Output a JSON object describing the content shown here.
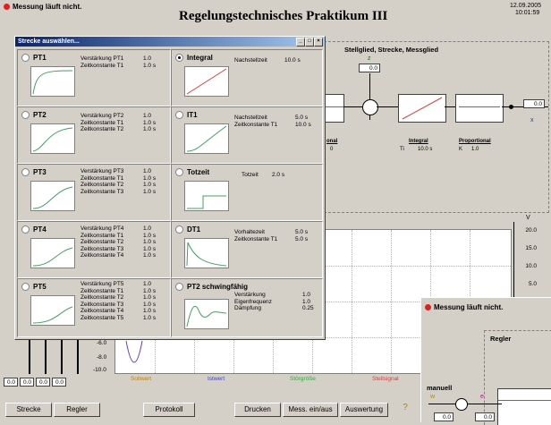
{
  "status": "Messung läuft nicht.",
  "title": "Regelungstechnisches Praktikum III",
  "date": "12.09.2005",
  "time": "10:01:59",
  "diagram": {
    "heading": "Stellglied, Strecke, Messglied",
    "z_label": "z",
    "z_value": "0.0",
    "x_label": "x",
    "x_value": "0.0",
    "blocks": [
      {
        "name": "onal",
        "param": "0"
      },
      {
        "name": "Integral",
        "param_label": "Ti",
        "param_value": "10.0 s"
      },
      {
        "name": "Proportional",
        "param_label": "K",
        "param_value": "1.0"
      }
    ]
  },
  "graph": {
    "unit": "V",
    "y_ticks": [
      "20.0",
      "15.0",
      "10.0",
      "5.0"
    ],
    "lower_ticks": [
      "-6.0",
      "-8.0",
      "-10.0"
    ],
    "legend": {
      "sollwert": "Sollwert",
      "istwert": "Istwert",
      "stoergroesse": "Störgröße",
      "stellsignal": "Stellsignal"
    },
    "colors": {
      "sollwert": "#c08000",
      "istwert": "#4040c0",
      "stoergroesse": "#40a040",
      "stellsignal": "#d04040"
    }
  },
  "slider_values": [
    "0.0",
    "0.0",
    "0.0",
    "0.0"
  ],
  "buttons": {
    "strecke": "Strecke",
    "regler": "Regler",
    "protokoll": "Protokoll",
    "drucken": "Drucken",
    "mess": "Mess. ein/aus",
    "auswertung": "Auswertung"
  },
  "dialog": {
    "title": "Strecke auswählen...",
    "controls": {
      "minimize": "_",
      "maximize": "□",
      "close": "×"
    },
    "left": [
      {
        "name": "PT1",
        "params": [
          [
            "Verstärkung PT1",
            "1.0"
          ],
          [
            "Zeitkonstante T1",
            "1.0 s"
          ]
        ]
      },
      {
        "name": "PT2",
        "params": [
          [
            "Verstärkung PT2",
            "1.0"
          ],
          [
            "Zeitkonstante T1",
            "1.0 s"
          ],
          [
            "Zeitkonstante T2",
            "1.0 s"
          ]
        ]
      },
      {
        "name": "PT3",
        "params": [
          [
            "Verstärkung PT3",
            "1.0"
          ],
          [
            "Zeitkonstante T1",
            "1.0 s"
          ],
          [
            "Zeitkonstante T2",
            "1.0 s"
          ],
          [
            "Zeitkonstante T3",
            "1.0 s"
          ]
        ]
      },
      {
        "name": "PT4",
        "params": [
          [
            "Verstärkung PT4",
            "1.0"
          ],
          [
            "Zeitkonstante T1",
            "1.0 s"
          ],
          [
            "Zeitkonstante T2",
            "1.0 s"
          ],
          [
            "Zeitkonstante T3",
            "1.0 s"
          ],
          [
            "Zeitkonstante T4",
            "1.0 s"
          ]
        ]
      },
      {
        "name": "PT5",
        "params": [
          [
            "Verstärkung PT5",
            "1.0"
          ],
          [
            "Zeitkonstante T1",
            "1.0 s"
          ],
          [
            "Zeitkonstante T2",
            "1.0 s"
          ],
          [
            "Zeitkonstante T3",
            "1.0 s"
          ],
          [
            "Zeitkonstante T4",
            "1.0 s"
          ],
          [
            "Zeitkonstante T5",
            "1.0 s"
          ]
        ]
      }
    ],
    "right": [
      {
        "name": "Integral",
        "selected": true,
        "params": [
          [
            "Nachstellzeit",
            "10.0 s"
          ]
        ]
      },
      {
        "name": "IT1",
        "params": [
          [
            "Nachstellzeit",
            "5.0 s"
          ],
          [
            "Zeitkonstante T1",
            "10.0 s"
          ]
        ]
      },
      {
        "name": "Totzeit",
        "params": [
          [
            "Totzeit",
            "2.0 s"
          ]
        ]
      },
      {
        "name": "DT1",
        "params": [
          [
            "Vorhaltezeit",
            "5.0 s"
          ],
          [
            "Zeitkonstante T1",
            "5.0 s"
          ]
        ]
      },
      {
        "name": "PT2 schwingfähig",
        "params": [
          [
            "Verstärkung",
            "1.0"
          ],
          [
            "Eigenfrequenz",
            "1.0"
          ],
          [
            "Dämpfung",
            "0.25"
          ]
        ]
      }
    ]
  },
  "second_window": {
    "status": "Messung läuft nicht.",
    "regler": "Regler",
    "manuell": "manuell",
    "w": "w",
    "e": "e",
    "val1": "0.0",
    "val2": "0.0"
  }
}
